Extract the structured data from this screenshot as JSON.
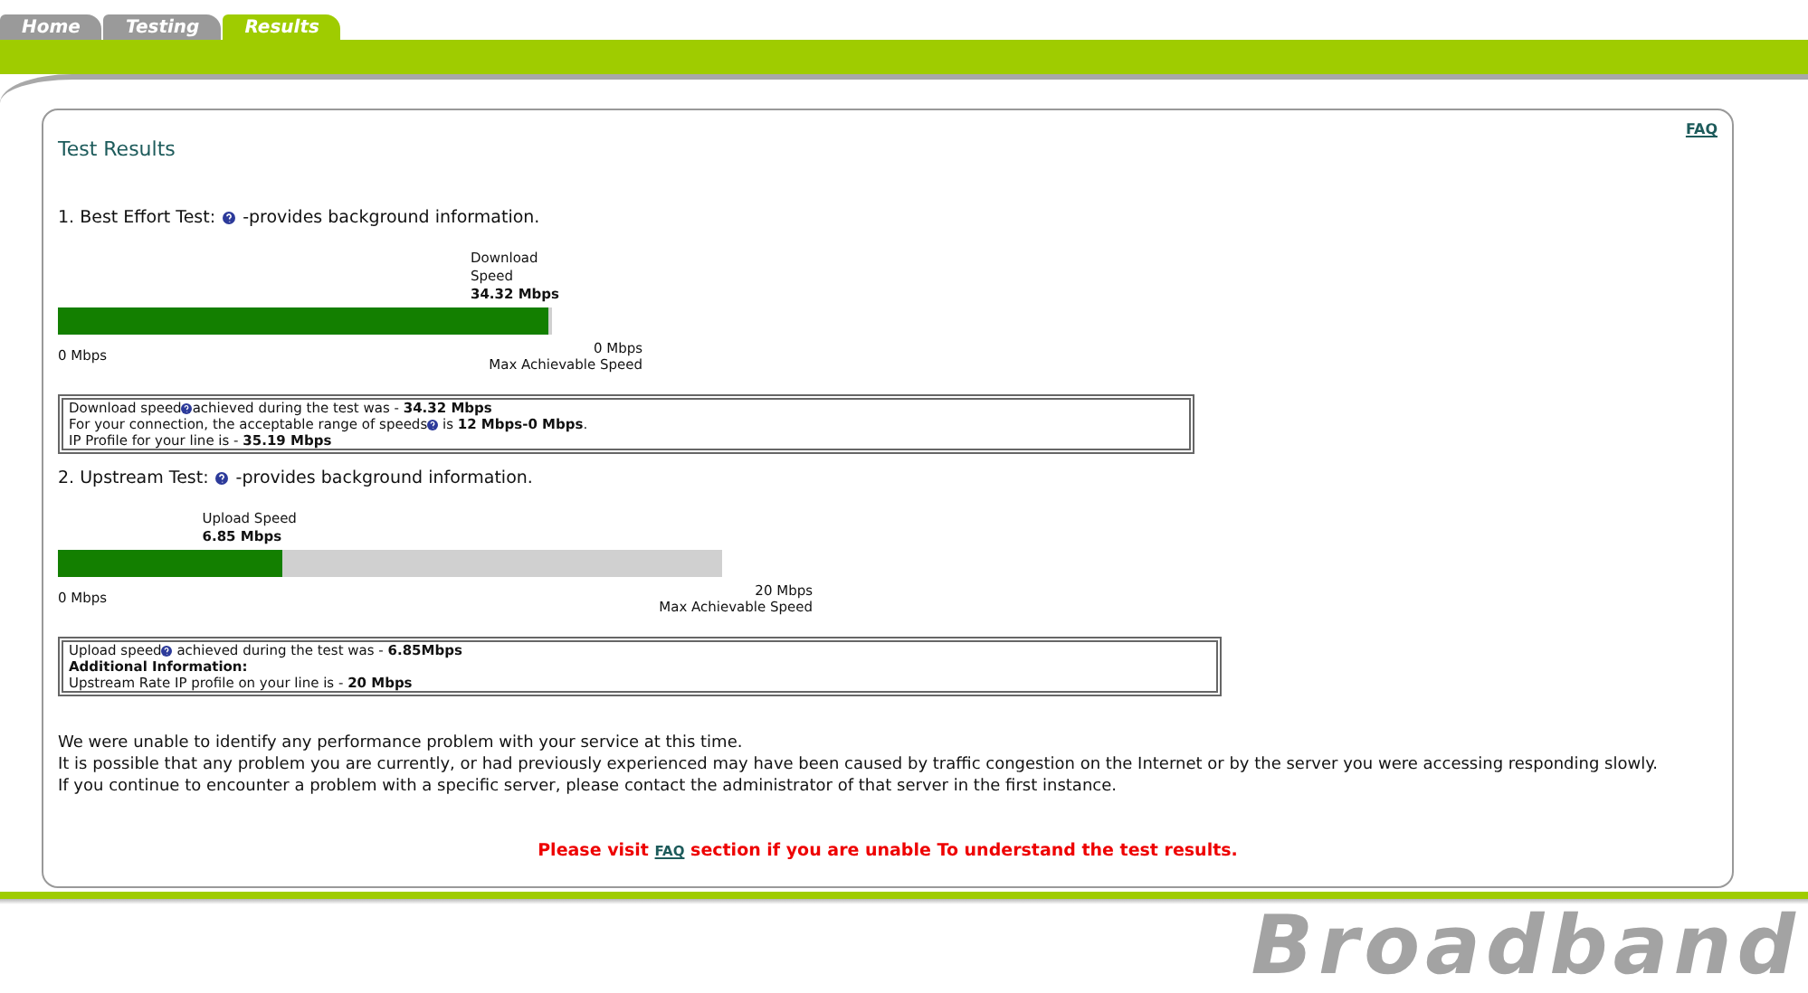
{
  "tabs": [
    {
      "label": "Home",
      "selected": false
    },
    {
      "label": "Testing",
      "selected": false
    },
    {
      "label": "Results",
      "selected": true
    }
  ],
  "title": "Test Results",
  "faq_link": "FAQ",
  "tests": [
    {
      "heading": "1. Best Effort Test:",
      "heading_note": "-provides background information.",
      "speed_label": "Download Speed",
      "speed_value": "34.32 Mbps",
      "level": 1,
      "min_label": "0 Mbps",
      "max_value": "0 Mbps",
      "max_label": "Max Achievable Speed",
      "info": [
        {
          "kind": "text",
          "lead": "Download speed",
          "rest": "achieved during the test was - **34.32 Mbps**"
        },
        {
          "kind": "text",
          "lead": "For your connection, the acceptable range of speeds",
          "rest": " is **12 Mbps-0 Mbps**."
        },
        {
          "kind": "text",
          "rest": "IP Profile for your line is - **35.19 Mbps**"
        }
      ]
    },
    {
      "heading": "2. Upstream Test:",
      "heading_note": "-provides background information.",
      "speed_label": "Upload Speed",
      "speed_value": "6.85 Mbps",
      "level": 0.34,
      "min_label": "0 Mbps",
      "max_value": "20 Mbps",
      "max_label": "Max Achievable Speed",
      "info": [
        {
          "kind": "text",
          "lead": "Upload speed",
          "rest": " achieved during the test was - **6.85Mbps**"
        },
        {
          "kind": "heading",
          "rest": "Additional Information:"
        },
        {
          "kind": "text",
          "rest": "Upstream Rate IP profile on your line is - **20 Mbps**"
        }
      ]
    }
  ],
  "messages": [
    "We were unable to identify any performance problem with your service at this time.",
    "It is possible that any problem you are currently, or had previously experienced may have been caused by traffic congestion on the Internet or by the server you were accessing responding slowly.",
    "If you continue to encounter a problem with a specific server, please contact the administrator of that server in the first instance."
  ],
  "notice": {
    "before": "Please visit",
    "link": "FAQ",
    "after": "section if you are unable To understand the test results."
  },
  "logo": "Broadband"
}
